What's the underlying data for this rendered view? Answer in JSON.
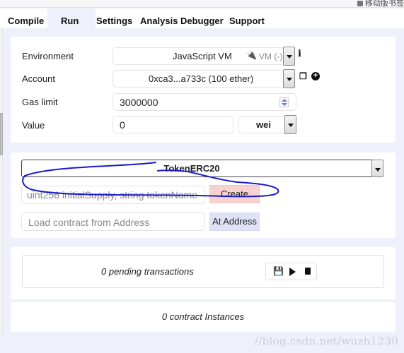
{
  "browser": {
    "bookmark_label": "移动版书签"
  },
  "tabs": [
    {
      "label": "Compile",
      "active": false
    },
    {
      "label": "Run",
      "active": true
    },
    {
      "label": "Settings",
      "active": false
    },
    {
      "label": "Analysis",
      "active": false
    },
    {
      "label": "Debugger",
      "active": false
    },
    {
      "label": "Support",
      "active": false
    }
  ],
  "settings": {
    "environment": {
      "label": "Environment",
      "value": "JavaScript VM",
      "badge": "VM (-)",
      "badge_icon": "plug-icon",
      "info_icon": "info-icon"
    },
    "account": {
      "label": "Account",
      "value": "0xca3...a733c (100 ether)",
      "copy_icon": "copy-icon",
      "add_icon": "plus-circle-icon"
    },
    "gas_limit": {
      "label": "Gas limit",
      "value": "3000000"
    },
    "value": {
      "label": "Value",
      "amount": "0",
      "unit": "wei"
    }
  },
  "contract": {
    "selected": "TokenERC20",
    "constructor_placeholder": "uint256 initialSupply, string tokenName",
    "create_label": "Create",
    "address_placeholder": "Load contract from Address",
    "at_address_label": "At Address"
  },
  "transactions": {
    "pending_text": "0 pending transactions",
    "tools": [
      "save-icon",
      "play-icon",
      "trash-icon"
    ]
  },
  "instances": {
    "text": "0 contract Instances"
  },
  "watermark": "//blog.csdn.net/wuzh1230",
  "colors": {
    "background": "#eef1fc",
    "create_button": "#f8d2d2",
    "at_address_button": "#dfe2f7",
    "annotation_stroke": "#1a1acc"
  }
}
